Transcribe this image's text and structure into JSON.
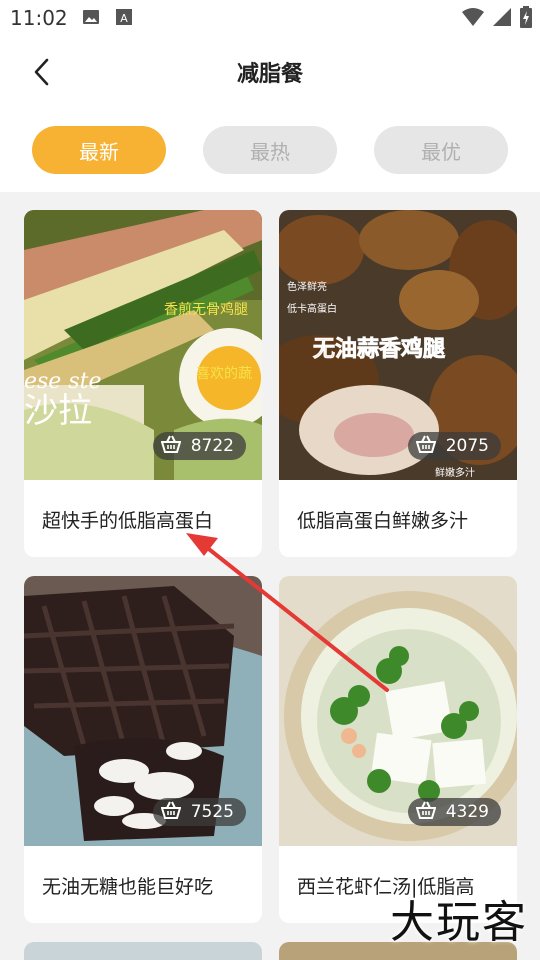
{
  "status_bar": {
    "time": "11:02",
    "left_icons": [
      "image-icon",
      "font-icon"
    ],
    "right_icons": [
      "wifi-icon",
      "signal-icon",
      "battery-icon"
    ]
  },
  "header": {
    "title": "减脂餐",
    "back_icon": "chevron-left-icon"
  },
  "tabs": [
    {
      "label": "最新",
      "active": true
    },
    {
      "label": "最热",
      "active": false
    },
    {
      "label": "最优",
      "active": false
    }
  ],
  "cards": [
    {
      "title": "超快手的低脂高蛋白",
      "count": "8722",
      "image_texts": [
        "香煎无骨鸡腿",
        "喜欢的蔬",
        "沙拉",
        "ese ste"
      ]
    },
    {
      "title": "低脂高蛋白鲜嫩多汁",
      "count": "2075",
      "image_texts": [
        "无油蒜香鸡腿",
        "色泽鲜亮",
        "低卡高蛋白",
        "鲜嫩多汁"
      ]
    },
    {
      "title": "无油无糖也能巨好吃",
      "count": "7525",
      "image_texts": []
    },
    {
      "title": "西兰花虾仁汤|低脂高",
      "count": "4329",
      "image_texts": []
    }
  ],
  "watermark": "大玩客",
  "colors": {
    "accent": "#f8b233",
    "tab_inactive_bg": "#e6e6e6",
    "annotation_arrow": "#e53935"
  }
}
